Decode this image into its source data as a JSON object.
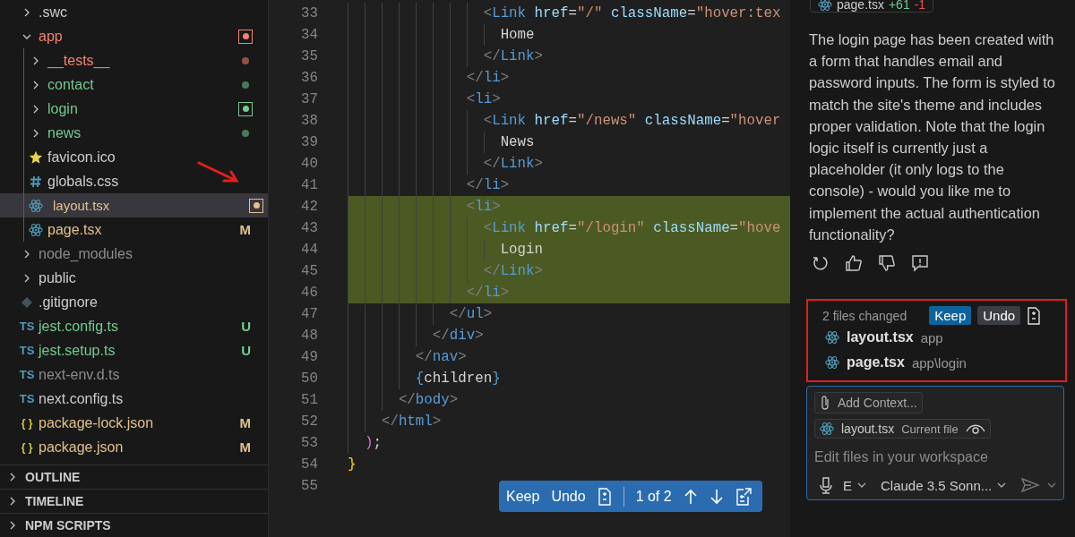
{
  "explorer": {
    "items": [
      {
        "name": ".swc",
        "kind": "folder",
        "expanded": false,
        "selected": false,
        "color": "#cccccc"
      },
      {
        "name": "app",
        "kind": "folder",
        "expanded": true,
        "selected": false,
        "color": "#f1826f",
        "decoration": {
          "kind": "boxed-dot"
        },
        "children": [
          {
            "name": "__tests__",
            "kind": "folder",
            "expanded": false,
            "selected": false,
            "color": "#f1826f",
            "decoration": {
              "kind": "dot"
            }
          },
          {
            "name": "contact",
            "kind": "folder",
            "expanded": false,
            "selected": false,
            "color": "#73c991",
            "decoration": {
              "kind": "dot"
            }
          },
          {
            "name": "login",
            "kind": "folder",
            "expanded": false,
            "selected": false,
            "color": "#73c991",
            "decoration": {
              "kind": "boxed-dot"
            }
          },
          {
            "name": "news",
            "kind": "folder",
            "expanded": false,
            "selected": false,
            "color": "#73c991",
            "decoration": {
              "kind": "dot"
            }
          },
          {
            "name": "favicon.ico",
            "kind": "star-file",
            "selected": false,
            "color": "#cccccc"
          },
          {
            "name": "globals.css",
            "kind": "css-file",
            "selected": false,
            "color": "#cccccc"
          },
          {
            "name": "layout.tsx",
            "kind": "react-file",
            "selected": true,
            "color": "#e2c08d",
            "decoration": {
              "kind": "boxed-dot"
            }
          },
          {
            "name": "page.tsx",
            "kind": "react-file",
            "selected": false,
            "color": "#e2c08d",
            "badge": "M"
          }
        ]
      },
      {
        "name": "node_modules",
        "kind": "folder",
        "expanded": false,
        "selected": false,
        "color": "#8c8c8c"
      },
      {
        "name": "public",
        "kind": "folder",
        "expanded": false,
        "selected": false,
        "color": "#cccccc"
      },
      {
        "name": ".gitignore",
        "kind": "git-file",
        "selected": false,
        "color": "#cccccc"
      },
      {
        "name": "jest.config.ts",
        "kind": "file",
        "glyph": "TS",
        "selected": false,
        "color": "#73c991",
        "badge": "U"
      },
      {
        "name": "jest.setup.ts",
        "kind": "file",
        "glyph": "TS",
        "selected": false,
        "color": "#73c991",
        "badge": "U"
      },
      {
        "name": "next-env.d.ts",
        "kind": "file",
        "glyph": "TS",
        "selected": false,
        "color": "#8c8c8c"
      },
      {
        "name": "next.config.ts",
        "kind": "file",
        "glyph": "TS",
        "selected": false,
        "color": "#cccccc"
      },
      {
        "name": "package-lock.json",
        "kind": "file",
        "glyph": "{ }",
        "selected": false,
        "color": "#e2c08d",
        "badge": "M"
      },
      {
        "name": "package.json",
        "kind": "file",
        "glyph": "{ }",
        "selected": false,
        "color": "#e2c08d",
        "badge": "M"
      }
    ]
  },
  "sections": [
    {
      "label": "OUTLINE",
      "expanded": false
    },
    {
      "label": "TIMELINE",
      "expanded": false
    },
    {
      "label": "NPM SCRIPTS",
      "expanded": false
    }
  ],
  "editor": {
    "lines": [
      {
        "number": "33",
        "added": false,
        "tokens": [
          {
            "kind": "punct",
            "t": "                <"
          },
          {
            "kind": "tag",
            "t": "Link"
          },
          {
            "kind": "attr",
            "t": " href"
          },
          {
            "kind": "plain",
            "t": "="
          },
          {
            "kind": "string",
            "t": "\"/\""
          },
          {
            "kind": "attr",
            "t": " className"
          },
          {
            "kind": "plain",
            "t": "="
          },
          {
            "kind": "string",
            "t": "\"hover:tex"
          }
        ]
      },
      {
        "number": "34",
        "added": false,
        "tokens": [
          {
            "kind": "plain",
            "t": "                  Home"
          }
        ]
      },
      {
        "number": "35",
        "added": false,
        "tokens": [
          {
            "kind": "punct",
            "t": "                </"
          },
          {
            "kind": "tag",
            "t": "Link"
          },
          {
            "kind": "punct",
            "t": ">"
          }
        ]
      },
      {
        "number": "36",
        "added": false,
        "tokens": [
          {
            "kind": "punct",
            "t": "              </"
          },
          {
            "kind": "tag",
            "t": "li"
          },
          {
            "kind": "punct",
            "t": ">"
          }
        ]
      },
      {
        "number": "37",
        "added": false,
        "tokens": [
          {
            "kind": "punct",
            "t": "              <"
          },
          {
            "kind": "tag",
            "t": "li"
          },
          {
            "kind": "punct",
            "t": ">"
          }
        ]
      },
      {
        "number": "38",
        "added": false,
        "tokens": [
          {
            "kind": "punct",
            "t": "                <"
          },
          {
            "kind": "tag",
            "t": "Link"
          },
          {
            "kind": "attr",
            "t": " href"
          },
          {
            "kind": "plain",
            "t": "="
          },
          {
            "kind": "string",
            "t": "\"/news\""
          },
          {
            "kind": "attr",
            "t": " className"
          },
          {
            "kind": "plain",
            "t": "="
          },
          {
            "kind": "string",
            "t": "\"hover"
          }
        ]
      },
      {
        "number": "39",
        "added": false,
        "tokens": [
          {
            "kind": "plain",
            "t": "                  News"
          }
        ]
      },
      {
        "number": "40",
        "added": false,
        "tokens": [
          {
            "kind": "punct",
            "t": "                </"
          },
          {
            "kind": "tag",
            "t": "Link"
          },
          {
            "kind": "punct",
            "t": ">"
          }
        ]
      },
      {
        "number": "41",
        "added": false,
        "tokens": [
          {
            "kind": "punct",
            "t": "              </"
          },
          {
            "kind": "tag",
            "t": "li"
          },
          {
            "kind": "punct",
            "t": ">"
          }
        ]
      },
      {
        "number": "42",
        "added": true,
        "tokens": [
          {
            "kind": "punct",
            "t": "              <"
          },
          {
            "kind": "tag",
            "t": "li"
          },
          {
            "kind": "punct",
            "t": ">"
          }
        ]
      },
      {
        "number": "43",
        "added": true,
        "tokens": [
          {
            "kind": "punct",
            "t": "                <"
          },
          {
            "kind": "tag",
            "t": "Link"
          },
          {
            "kind": "attr",
            "t": " href"
          },
          {
            "kind": "plain",
            "t": "="
          },
          {
            "kind": "string",
            "t": "\"/login\""
          },
          {
            "kind": "attr",
            "t": " className"
          },
          {
            "kind": "plain",
            "t": "="
          },
          {
            "kind": "string",
            "t": "\"hove"
          }
        ]
      },
      {
        "number": "44",
        "added": true,
        "tokens": [
          {
            "kind": "plain",
            "t": "                  Login"
          }
        ]
      },
      {
        "number": "45",
        "added": true,
        "tokens": [
          {
            "kind": "punct",
            "t": "                </"
          },
          {
            "kind": "tag",
            "t": "Link"
          },
          {
            "kind": "punct",
            "t": ">"
          }
        ]
      },
      {
        "number": "46",
        "added": true,
        "tokens": [
          {
            "kind": "punct",
            "t": "              </"
          },
          {
            "kind": "tag",
            "t": "li"
          },
          {
            "kind": "punct",
            "t": ">"
          }
        ]
      },
      {
        "number": "47",
        "added": false,
        "tokens": [
          {
            "kind": "punct",
            "t": "            </"
          },
          {
            "kind": "tag",
            "t": "ul"
          },
          {
            "kind": "punct",
            "t": ">"
          }
        ]
      },
      {
        "number": "48",
        "added": false,
        "tokens": [
          {
            "kind": "punct",
            "t": "          </"
          },
          {
            "kind": "tag",
            "t": "div"
          },
          {
            "kind": "punct",
            "t": ">"
          }
        ]
      },
      {
        "number": "49",
        "added": false,
        "tokens": [
          {
            "kind": "punct",
            "t": "        </"
          },
          {
            "kind": "tag",
            "t": "nav"
          },
          {
            "kind": "punct",
            "t": ">"
          }
        ]
      },
      {
        "number": "50",
        "added": false,
        "tokens": [
          {
            "kind": "brace",
            "t": "        {"
          },
          {
            "kind": "plain",
            "t": "children"
          },
          {
            "kind": "brace",
            "t": "}"
          }
        ]
      },
      {
        "number": "51",
        "added": false,
        "tokens": [
          {
            "kind": "punct",
            "t": "      </"
          },
          {
            "kind": "tag",
            "t": "body"
          },
          {
            "kind": "punct",
            "t": ">"
          }
        ]
      },
      {
        "number": "52",
        "added": false,
        "tokens": [
          {
            "kind": "punct",
            "t": "    </"
          },
          {
            "kind": "tag",
            "t": "html"
          },
          {
            "kind": "punct",
            "t": ">"
          }
        ]
      },
      {
        "number": "53",
        "added": false,
        "tokens": [
          {
            "kind": "paren",
            "t": "  )"
          },
          {
            "kind": "plain",
            "t": ";"
          }
        ]
      },
      {
        "number": "54",
        "added": false,
        "tokens": [
          {
            "kind": "curly",
            "t": "}"
          }
        ]
      },
      {
        "number": "55",
        "added": false
      }
    ],
    "diff_toolbar": {
      "keep": "Keep",
      "undo": "Undo",
      "position": "1 of 2"
    }
  },
  "chat": {
    "file_pill": {
      "name": "page.tsx",
      "added": "+61",
      "removed": "-1"
    },
    "message": "The login page has been created with a form that handles email and password inputs. The form is styled to match the site's theme and includes proper validation. Note that the login logic itself is currently just a placeholder (it only logs to the console) - would you like me to implement the actual authentication functionality?",
    "changes": {
      "summary": "2 files changed",
      "keep": "Keep",
      "undo": "Undo",
      "files": [
        {
          "name": "layout.tsx",
          "path": "app"
        },
        {
          "name": "page.tsx",
          "path": "app\\login"
        }
      ]
    },
    "input": {
      "add_context": "Add Context...",
      "current_file": {
        "name": "layout.tsx",
        "label": "Current file"
      },
      "placeholder": "Edit files in your workspace",
      "mode": "E",
      "model": "Claude 3.5 Sonn..."
    }
  }
}
